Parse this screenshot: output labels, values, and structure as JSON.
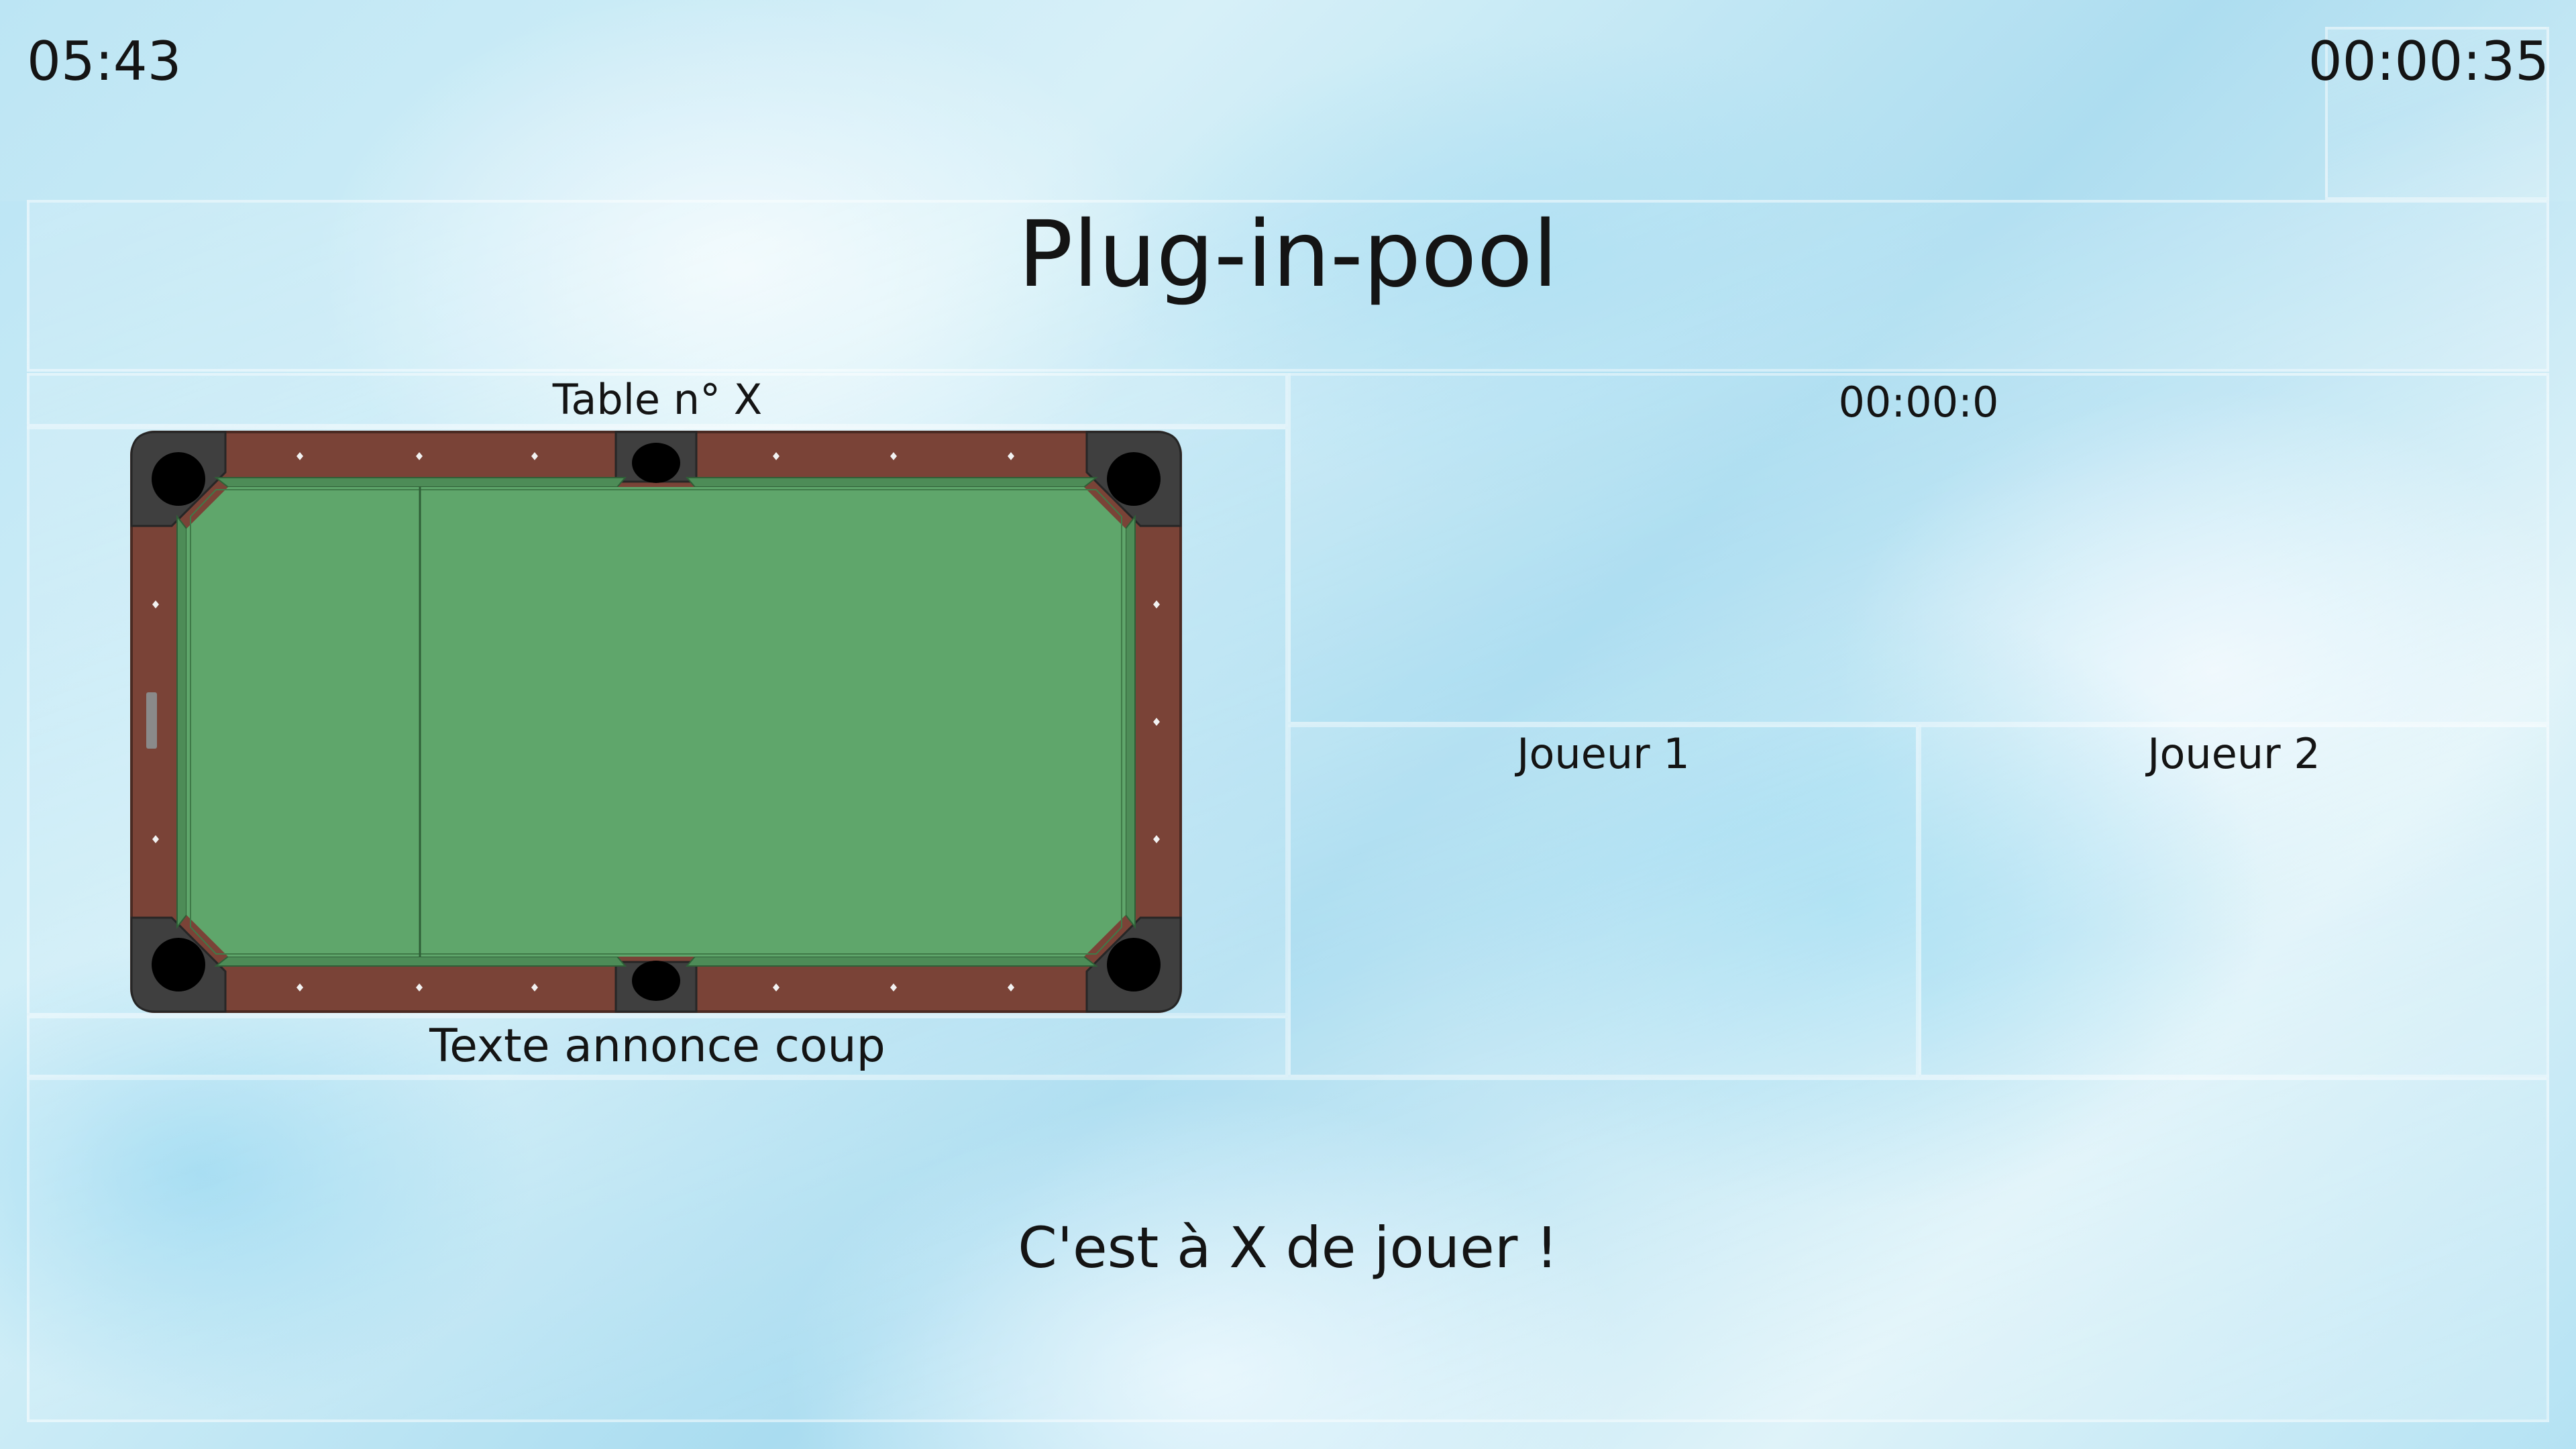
{
  "header": {
    "clock": "05:43",
    "elapsed": "00:00:35",
    "title": "Plug-in-pool"
  },
  "table_panel": {
    "table_label": "Table n° X",
    "shot_announcement": "Texte annonce coup",
    "felt_color": "#5fa66b",
    "rail_color": "#7a4337",
    "pocket_color": "#000000"
  },
  "shot_panel": {
    "shot_timer": "00:00:0"
  },
  "players": [
    {
      "label": "Joueur 1"
    },
    {
      "label": "Joueur 2"
    }
  ],
  "status": {
    "turn_message": "C'est à X de jouer !"
  }
}
